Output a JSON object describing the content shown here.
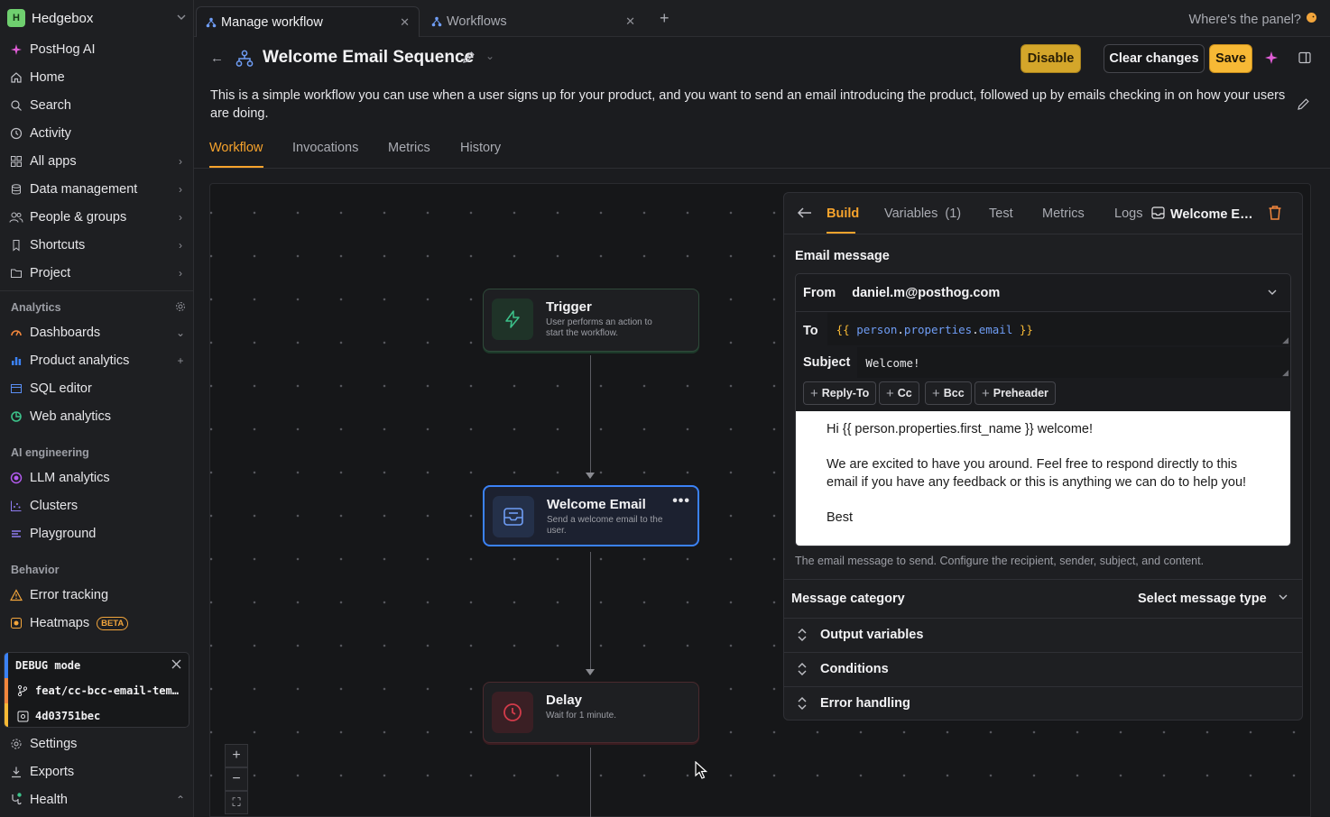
{
  "colors": {
    "accent": "#f7a32c",
    "selected_node": "#3b82f6",
    "bg": "#1b1c1f"
  },
  "sidebar": {
    "org": {
      "badge": "H",
      "name": "Hedgebox"
    },
    "items": [
      {
        "label": "PostHog AI",
        "icon": "sparkle-icon"
      },
      {
        "label": "Home",
        "icon": "home-icon"
      },
      {
        "label": "Search",
        "icon": "search-icon"
      },
      {
        "label": "Activity",
        "icon": "clock-icon"
      },
      {
        "label": "All apps",
        "icon": "grid-icon"
      },
      {
        "label": "Data management",
        "icon": "database-icon"
      },
      {
        "label": "People & groups",
        "icon": "people-icon"
      },
      {
        "label": "Shortcuts",
        "icon": "bookmark-icon"
      },
      {
        "label": "Project",
        "icon": "folder-icon"
      }
    ],
    "sections": {
      "analytics": {
        "title": "Analytics",
        "items": [
          {
            "label": "Dashboards",
            "icon": "dashboard-icon"
          },
          {
            "label": "Product analytics",
            "icon": "bar-chart-icon"
          },
          {
            "label": "SQL editor",
            "icon": "sql-icon"
          },
          {
            "label": "Web analytics",
            "icon": "web-analytics-icon"
          }
        ]
      },
      "ai": {
        "title": "AI engineering",
        "items": [
          {
            "label": "LLM analytics",
            "icon": "llm-icon"
          },
          {
            "label": "Clusters",
            "icon": "clusters-icon"
          },
          {
            "label": "Playground",
            "icon": "playground-icon"
          }
        ]
      },
      "behavior": {
        "title": "Behavior",
        "items": [
          {
            "label": "Error tracking",
            "icon": "warning-icon"
          },
          {
            "label": "Heatmaps",
            "icon": "heatmap-icon",
            "badge": "BETA"
          }
        ]
      }
    },
    "debug": {
      "mode": "DEBUG mode",
      "branch": "feat/cc-bcc-email-tem…",
      "commit": "4d03751bec"
    },
    "bottom": [
      {
        "label": "Settings",
        "icon": "gear-icon"
      },
      {
        "label": "Exports",
        "icon": "download-icon"
      },
      {
        "label": "Health",
        "icon": "stethoscope-icon"
      }
    ]
  },
  "tabs": [
    {
      "label": "Manage workflow",
      "active": true
    },
    {
      "label": "Workflows",
      "active": false
    }
  ],
  "panel_hint": "Where's the panel?",
  "header": {
    "title": "Welcome Email Sequence",
    "description": "This is a simple workflow you can use when a user signs up for your product, and you want to send an email introducing the product, followed up by emails checking in on how your users are doing.",
    "buttons": {
      "disable": "Disable",
      "clear": "Clear changes",
      "save": "Save"
    },
    "page_tabs": [
      "Workflow",
      "Invocations",
      "Metrics",
      "History"
    ]
  },
  "nodes": [
    {
      "title": "Trigger",
      "desc": "User performs an action to start the workflow.",
      "icon": "lightning-icon"
    },
    {
      "title": "Welcome Email",
      "desc": "Send a welcome email to the user.",
      "icon": "inbox-icon"
    },
    {
      "title": "Delay",
      "desc": "Wait for 1 minute.",
      "icon": "clock-icon"
    }
  ],
  "zoom": {
    "in": "+",
    "out": "−",
    "fit": "⛶"
  },
  "panel": {
    "tabs": {
      "build": "Build",
      "variables": "Variables",
      "variables_count": "(1)",
      "test": "Test",
      "metrics": "Metrics",
      "logs": "Logs"
    },
    "node_name": "Welcome E…",
    "email_heading": "Email message",
    "from_label": "From",
    "from_value": "daniel.m@posthog.com",
    "to_label": "To",
    "to_value": {
      "open": "{{",
      "obj": "person",
      "dot1": ".",
      "prop": "properties",
      "dot2": ".",
      "field": "email",
      "close": "}}"
    },
    "subject_label": "Subject",
    "subject_value": "Welcome!",
    "chips": [
      "Reply-To",
      "Cc",
      "Bcc",
      "Preheader"
    ],
    "body": [
      "Hi {{ person.properties.first_name }} welcome!",
      "We are excited to have you around. Feel free to respond directly to this email if you have any feedback or this is anything we can do to help you!",
      "Best"
    ],
    "help_text": "The email message to send. Configure the recipient, sender, subject, and content.",
    "message_category_label": "Message category",
    "message_category_placeholder": "Select message type",
    "collapsibles": [
      "Output variables",
      "Conditions",
      "Error handling"
    ]
  }
}
